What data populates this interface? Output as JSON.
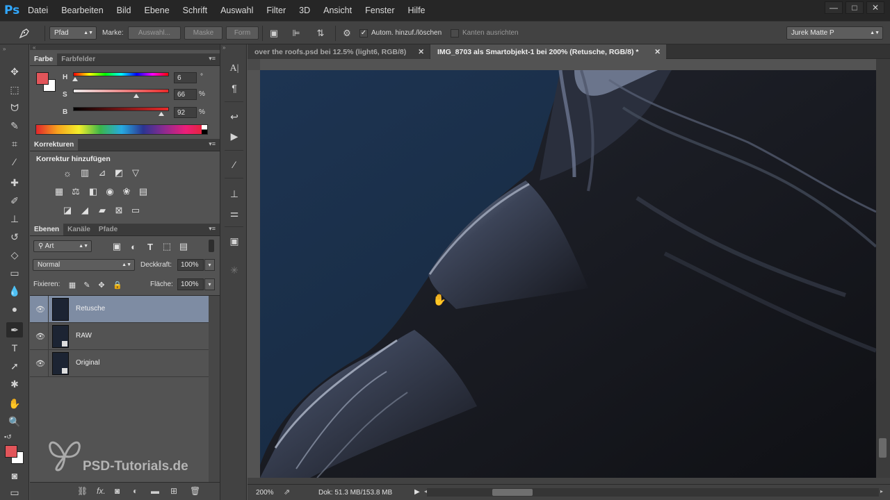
{
  "app": {
    "logo": "Ps"
  },
  "menu": [
    "Datei",
    "Bearbeiten",
    "Bild",
    "Ebene",
    "Schrift",
    "Auswahl",
    "Filter",
    "3D",
    "Ansicht",
    "Fenster",
    "Hilfe"
  ],
  "window_controls": {
    "minimize": "—",
    "maximize": "□",
    "close": "✕"
  },
  "options_bar": {
    "mode_select": "Pfad",
    "make_label": "Marke:",
    "selection_button": "Auswahl...",
    "mask_button": "Maske",
    "shape_button": "Form",
    "auto_add_delete": {
      "label": "Autom. hinzuf./löschen",
      "checked": true
    },
    "align_edges": {
      "label": "Kanten ausrichten",
      "checked": false
    },
    "workspace": "Jurek Matte P"
  },
  "color_panel": {
    "tabs": [
      "Farbe",
      "Farbfelder"
    ],
    "foreground": "#e2555a",
    "background": "#ffffff",
    "h": {
      "label": "H",
      "value": "6",
      "unit": "°",
      "fraction": 0.02
    },
    "s": {
      "label": "S",
      "value": "66",
      "unit": "%",
      "fraction": 0.66
    },
    "b": {
      "label": "B",
      "value": "92",
      "unit": "%",
      "fraction": 0.92
    }
  },
  "adjustments_panel": {
    "tab": "Korrekturen",
    "title": "Korrektur hinzufügen"
  },
  "layers_panel": {
    "tabs": [
      "Ebenen",
      "Kanäle",
      "Pfade"
    ],
    "filter": "Art",
    "blend_mode": "Normal",
    "opacity_label": "Deckkraft:",
    "opacity": "100%",
    "lock_label": "Fixieren:",
    "fill_label": "Fläche:",
    "fill": "100%",
    "layers": [
      {
        "name": "Retusche",
        "selected": true
      },
      {
        "name": "RAW",
        "selected": false
      },
      {
        "name": "Original",
        "selected": false
      }
    ]
  },
  "documents": [
    {
      "title": "over the roofs.psd bei 12.5% (light6, RGB/8)",
      "active": false
    },
    {
      "title": "IMG_8703 als Smartobjekt-1 bei 200% (Retusche, RGB/8) *",
      "active": true
    }
  ],
  "status": {
    "zoom": "200%",
    "doc_info": "Dok: 51.3 MB/153.8 MB"
  },
  "watermark": "PSD-Tutorials.de"
}
